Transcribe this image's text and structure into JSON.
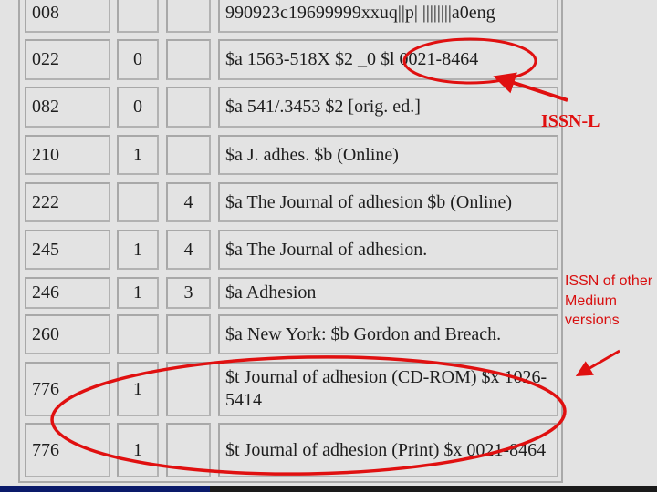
{
  "rows": [
    {
      "tag": "008",
      "ind1": "",
      "ind2": "",
      "content": "990923c19699999xxuq||p| ||||||||a0eng"
    },
    {
      "tag": "022",
      "ind1": "0",
      "ind2": "",
      "content": "$a 1563-518X $2 _0 $l 0021-8464"
    },
    {
      "tag": "082",
      "ind1": "0",
      "ind2": "",
      "content": "$a 541/.3453 $2 [orig. ed.]"
    },
    {
      "tag": "210",
      "ind1": "1",
      "ind2": "",
      "content": "$a J. adhes. $b (Online)"
    },
    {
      "tag": "222",
      "ind1": "",
      "ind2": "4",
      "content": "$a The Journal of adhesion $b (Online)"
    },
    {
      "tag": "245",
      "ind1": "1",
      "ind2": "4",
      "content": "$a The Journal of adhesion."
    },
    {
      "tag": "246",
      "ind1": "1",
      "ind2": "3",
      "content": "$a Adhesion"
    },
    {
      "tag": "260",
      "ind1": "",
      "ind2": "",
      "content": "$a New York: $b Gordon and Breach."
    },
    {
      "tag": "776",
      "ind1": "1",
      "ind2": "",
      "content": "$t Journal of adhesion (CD-ROM) $x 1026-5414"
    },
    {
      "tag": "776",
      "ind1": "1",
      "ind2": "",
      "content": "$t Journal of adhesion (Print) $x 0021-8464"
    }
  ],
  "annotations": {
    "issn_l": "ISSN-L",
    "other_medium": "ISSN of other Medium versions",
    "color": "#e01010"
  }
}
